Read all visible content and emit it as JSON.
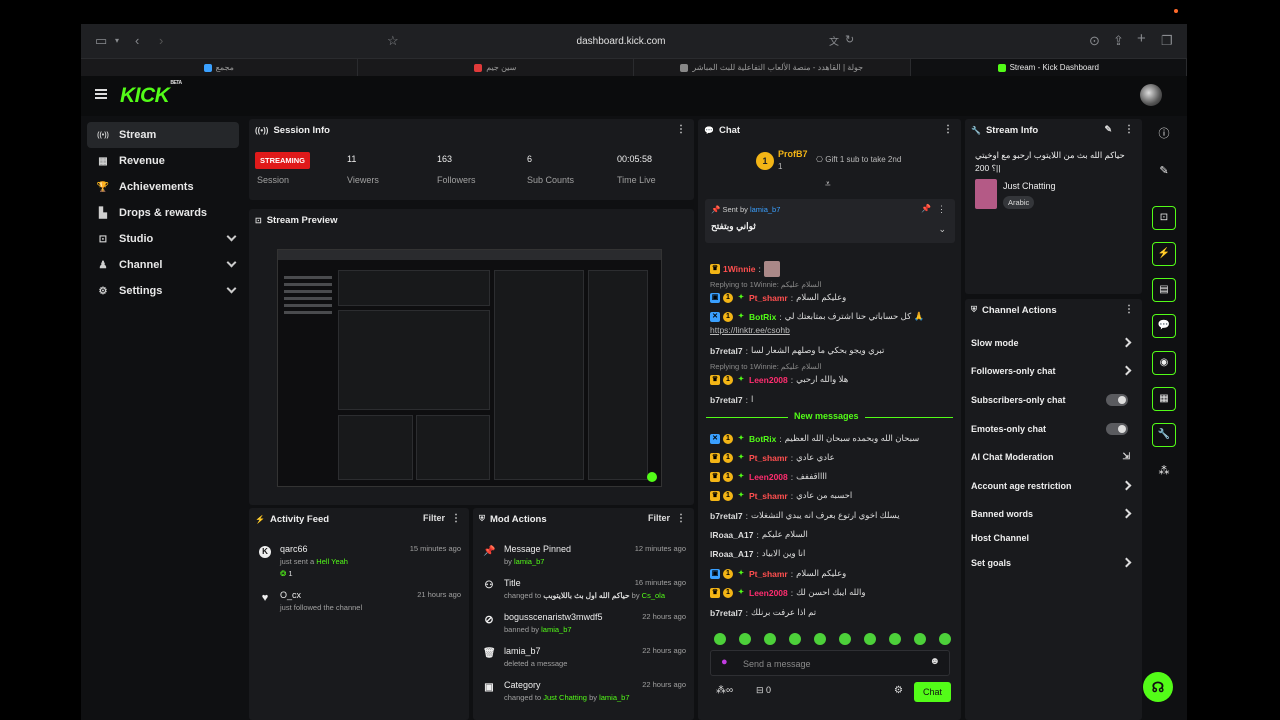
{
  "browser": {
    "url": "dashboard.kick.com",
    "tabs": [
      {
        "label": "مجمع",
        "color": "#3aa0ff"
      },
      {
        "label": "سين جيم",
        "color": "#e03a3a"
      },
      {
        "label": "جولة | القاهدد - منصة الألعاب التفاعلية للبث المباشر",
        "color": "#888888"
      },
      {
        "label": "Stream - Kick Dashboard",
        "color": "#53fc18",
        "active": true
      }
    ]
  },
  "brand": {
    "logo": "KICK",
    "beta": "BETA",
    "accent": "#53fc18"
  },
  "sidebar": {
    "items": [
      {
        "label": "Stream",
        "icon": "stream-icon",
        "glyph": "((•))",
        "active": true
      },
      {
        "label": "Revenue",
        "icon": "revenue-icon",
        "glyph": "▦"
      },
      {
        "label": "Achievements",
        "icon": "trophy-icon",
        "glyph": "🏆"
      },
      {
        "label": "Drops & rewards",
        "icon": "drops-icon",
        "glyph": "▙"
      },
      {
        "label": "Studio",
        "icon": "studio-icon",
        "glyph": "⊡",
        "expand": true
      },
      {
        "label": "Channel",
        "icon": "channel-icon",
        "glyph": "♟",
        "expand": true
      },
      {
        "label": "Settings",
        "icon": "gear-icon",
        "glyph": "⚙",
        "expand": true
      }
    ]
  },
  "session": {
    "title": "Session Info",
    "status": "STREAMING",
    "status_label": "Session",
    "stats": [
      {
        "value": "11",
        "label": "Viewers"
      },
      {
        "value": "163",
        "label": "Followers"
      },
      {
        "value": "6",
        "label": "Sub Counts"
      },
      {
        "value": "00:05:58",
        "label": "Time Live"
      }
    ]
  },
  "preview": {
    "title": "Stream Preview"
  },
  "activity": {
    "title": "Activity Feed",
    "filter": "Filter",
    "items": [
      {
        "name": "qarc66",
        "sub_prefix": "just sent a ",
        "sub_highlight": "Hell Yeah",
        "extra": "1",
        "time": "15 minutes ago",
        "icon": "kick-icon"
      },
      {
        "name": "O_cx",
        "sub_prefix": "just followed the channel",
        "sub_highlight": "",
        "extra": "",
        "time": "21 hours ago",
        "icon": "heart-icon"
      }
    ]
  },
  "mod": {
    "title": "Mod Actions",
    "filter": "Filter",
    "items": [
      {
        "title": "Message Pinned",
        "line_prefix": "by ",
        "line_hl": "lamia_b7",
        "line_mid": "",
        "line_hl2": "",
        "time": "12 minutes ago",
        "icon": "pin-icon",
        "glyph": "📌"
      },
      {
        "title": "Title",
        "line_prefix": "changed to ",
        "line_hl": "",
        "line_mid": "حياكم الله اول بث باللايتوبب",
        "line_hl2": "Cs_ola",
        "time": "16 minutes ago",
        "icon": "title-icon",
        "glyph": "⚇"
      },
      {
        "title": "bogusscenaristw3mwdf5",
        "line_prefix": "banned by ",
        "line_hl": "lamia_b7",
        "line_mid": "",
        "line_hl2": "",
        "time": "22 hours ago",
        "icon": "ban-icon",
        "glyph": "⊘"
      },
      {
        "title": "lamia_b7",
        "line_prefix": "deleted a message",
        "line_hl": "",
        "line_mid": "",
        "line_hl2": "",
        "time": "22 hours ago",
        "icon": "trash-icon",
        "glyph": "🗑"
      },
      {
        "title": "Category",
        "line_prefix": "changed to ",
        "line_hl": "Just Chatting",
        "line_mid": " by ",
        "line_hl2": "lamia_b7",
        "time": "22 hours ago",
        "icon": "category-icon",
        "glyph": "▣"
      }
    ]
  },
  "chat": {
    "title": "Chat",
    "gifter": {
      "name": "ProfB7",
      "count": "1",
      "rank": "1"
    },
    "gift_text": "Gift 1 sub to take 2nd",
    "pinned": {
      "label": "Sent by",
      "user": "lamia_b7",
      "text": "ثواني وبتفتح"
    },
    "messages_top": [
      {
        "type": "msg",
        "user": "1Winnie",
        "color": "#ff4f4f",
        "text": ""
      },
      {
        "type": "reply",
        "text": "Replying to 1Winnie: السلام عليكم"
      },
      {
        "type": "msg",
        "user": "Pt_shamr",
        "color": "#ff4f4f",
        "text": "وعليكم السلام"
      },
      {
        "type": "msg",
        "user": "BotRix",
        "color": "#53fc18",
        "text": "كل حساباتي حنا اشترف بمتابعتك لي 🙏"
      },
      {
        "type": "link",
        "text": "https://linktr.ee/csohb"
      },
      {
        "type": "msg",
        "user": "b7retal7",
        "color": "#dddddd",
        "text": "تبري ويجو بحكي ما وصلهم الشعار لسا"
      },
      {
        "type": "reply",
        "text": "Replying to 1Winnie: السلام عليكم"
      },
      {
        "type": "msg",
        "user": "Leen2008",
        "color": "#ff2d6f",
        "text": "هلا والله ارحبي"
      },
      {
        "type": "msg",
        "user": "b7retal7",
        "color": "#dddddd",
        "text": "ا"
      }
    ],
    "new_messages": "New messages",
    "messages_bottom": [
      {
        "user": "BotRix",
        "color": "#53fc18",
        "text": "سبحان الله وبحمده سبحان الله العظيم"
      },
      {
        "user": "Pt_shamr",
        "color": "#ff4f4f",
        "text": "عادي عادي"
      },
      {
        "user": "Leen2008",
        "color": "#ff2d6f",
        "text": "ااااقففف"
      },
      {
        "user": "Pt_shamr",
        "color": "#ff4f4f",
        "text": "احسبه من عادي"
      },
      {
        "user": "b7retal7",
        "color": "#dddddd",
        "text": "يسلك اخوي ارتوع بعرف انه يبدي التشغلات"
      },
      {
        "user": "lRoaa_A17",
        "color": "#dddddd",
        "text": "السلام عليكم"
      },
      {
        "user": "lRoaa_A17",
        "color": "#dddddd",
        "text": "انا وين الابياد"
      },
      {
        "user": "Pt_shamr",
        "color": "#ff4f4f",
        "text": "وعليكم السلام"
      },
      {
        "user": "Leen2008",
        "color": "#ff2d6f",
        "text": "والله ايبك احسن لك"
      },
      {
        "user": "b7retal7",
        "color": "#dddddd",
        "text": "تم اذا عرفت برنلك"
      }
    ],
    "placeholder": "Send a message",
    "footer_count": "0",
    "chat_button": "Chat"
  },
  "stream_info": {
    "title": "Stream Info",
    "stream_title": "حياكم الله بث من اللايتوب ارحبو مع اوخيتي ||؟ 200",
    "category": "Just Chatting",
    "tag": "Arabic"
  },
  "channel_actions": {
    "title": "Channel Actions",
    "items": [
      {
        "label": "Slow mode",
        "kind": "arrow"
      },
      {
        "label": "Followers-only chat",
        "kind": "arrow"
      },
      {
        "label": "Subscribers-only chat",
        "kind": "toggle"
      },
      {
        "label": "Emotes-only chat",
        "kind": "toggle"
      },
      {
        "label": "AI Chat Moderation",
        "kind": "external"
      },
      {
        "label": "Account age restriction",
        "kind": "arrow"
      },
      {
        "label": "Banned words",
        "kind": "arrow"
      },
      {
        "label": "Host Channel",
        "kind": "none"
      },
      {
        "label": "Set goals",
        "kind": "arrow"
      }
    ]
  },
  "rail": {
    "buttons": [
      "info-icon",
      "pencil-icon",
      "screen-icon",
      "bolt-icon",
      "notes-icon",
      "chat-icon",
      "broadcast-icon",
      "layout-icon",
      "wrench-icon",
      "apps-icon"
    ]
  }
}
